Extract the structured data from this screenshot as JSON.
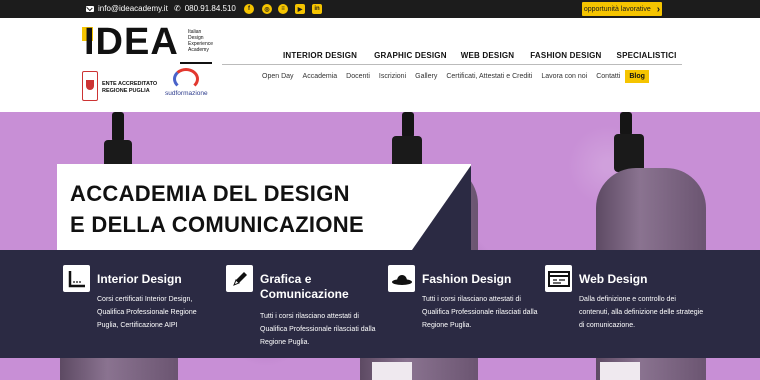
{
  "topbar": {
    "email": "info@ideacademy.it",
    "phone": "080.91.84.510",
    "social": [
      {
        "icon": "facebook-icon",
        "glyph": "f"
      },
      {
        "icon": "instagram-icon",
        "glyph": "◎"
      },
      {
        "icon": "spotify-icon",
        "glyph": "≡"
      },
      {
        "icon": "youtube-icon",
        "glyph": "▶"
      },
      {
        "icon": "linkedin-icon",
        "glyph": "in"
      }
    ],
    "cta_label": "opportunità lavorative",
    "cta_arrow": "›"
  },
  "brand": {
    "logo_text": "IDEA",
    "logo_sub": "Italian\nDesign\nExperience\nAcademy",
    "region_badge": "ENTE ACCREDITATO\nREGIONE PUGLIA",
    "partner": "sudformazione"
  },
  "main_nav": [
    "INTERIOR DESIGN",
    "GRAPHIC DESIGN",
    "WEB DESIGN",
    "FASHION DESIGN",
    "SPECIALISTICI"
  ],
  "sub_nav": [
    "Open Day",
    "Accademia",
    "Docenti",
    "Iscrizioni",
    "Gallery",
    "Certificati, Attestati e Crediti",
    "Lavora con noi",
    "Contatti"
  ],
  "blog_label": "Blog",
  "hero": {
    "title": "ACCADEMIA DEL DESIGN\nE DELLA COMUNICAZIONE"
  },
  "features": [
    {
      "icon": "ruler-square-icon",
      "title": "Interior Design",
      "desc": "Corsi certificati Interior Design,\nQualifica Professionale Regione\nPuglia, Certificazione AIPI"
    },
    {
      "icon": "pencil-icon",
      "title": "Grafica e\nComunicazione",
      "desc": "Tutti i corsi rilasciano attestati di\nQualifica Professionale rilasciati dalla\nRegione Puglia."
    },
    {
      "icon": "hat-icon",
      "title": "Fashion Design",
      "desc": "Tutti i corsi rilasciano attestati di\nQualifica Professionale rilasciati dalla\nRegione Puglia."
    },
    {
      "icon": "browser-window-icon",
      "title": "Web Design",
      "desc": "Dalla definizione e controllo dei\ncontenuti, alla definizione delle strategie\ndi comunicazione."
    }
  ],
  "colors": {
    "accent": "#f5c400",
    "band": "#2b2a43",
    "hero_bg": "#c88fd6"
  }
}
